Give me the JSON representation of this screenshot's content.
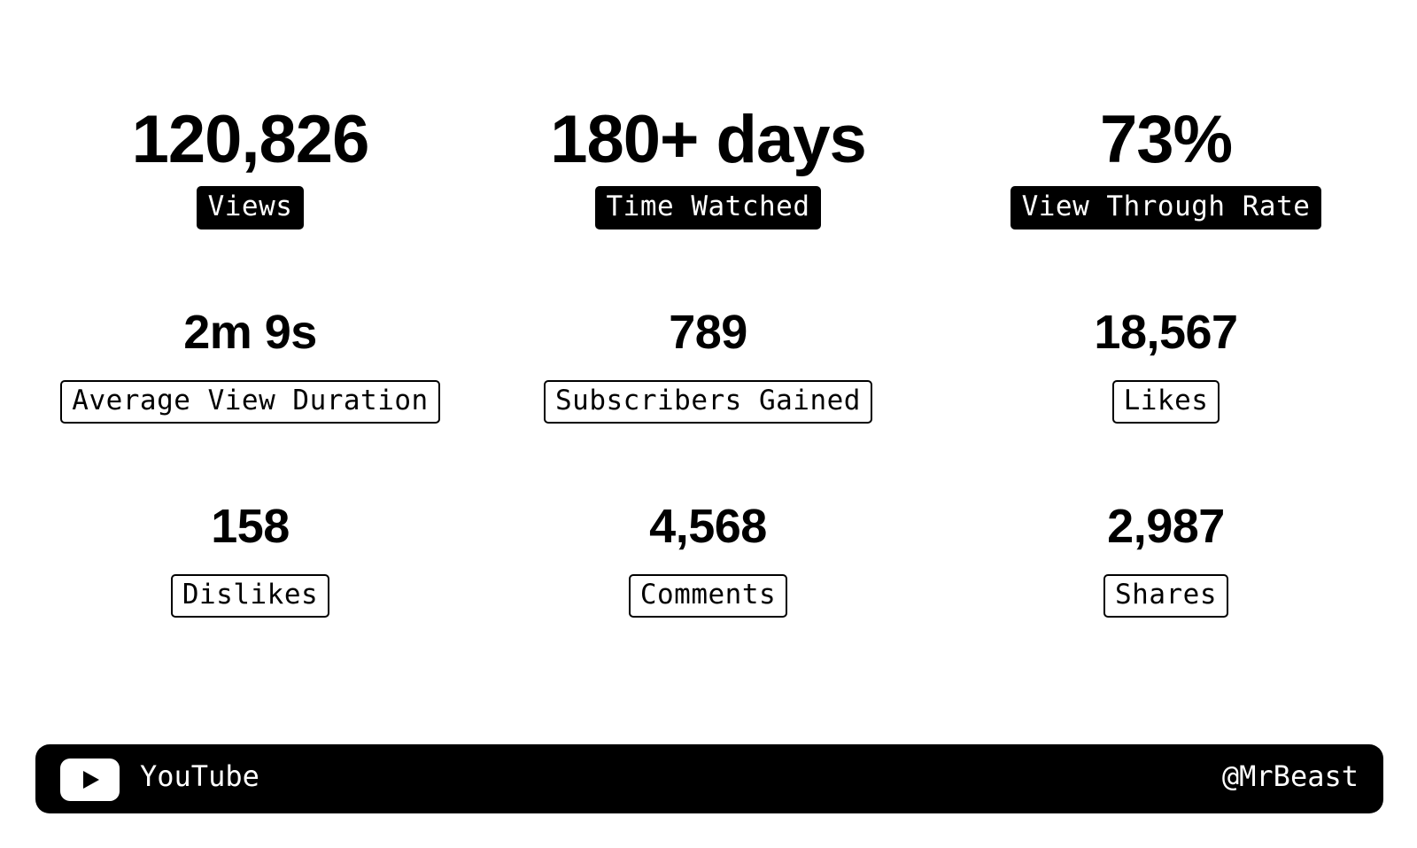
{
  "stats": [
    {
      "value": "120,826",
      "label": "Views"
    },
    {
      "value": "180+ days",
      "label": "Time Watched"
    },
    {
      "value": "73%",
      "label": "View Through Rate"
    },
    {
      "value": "2m 9s",
      "label": "Average View Duration"
    },
    {
      "value": "789",
      "label": "Subscribers Gained"
    },
    {
      "value": "18,567",
      "label": "Likes"
    },
    {
      "value": "158",
      "label": "Dislikes"
    },
    {
      "value": "4,568",
      "label": "Comments"
    },
    {
      "value": "2,987",
      "label": "Shares"
    }
  ],
  "footer": {
    "icon": "youtube-play-icon",
    "platform": "YouTube",
    "handle": "@MrBeast"
  },
  "colors": {
    "background": "#ffffff",
    "text": "#000000",
    "footer_background": "#000000",
    "footer_text": "#ffffff"
  }
}
